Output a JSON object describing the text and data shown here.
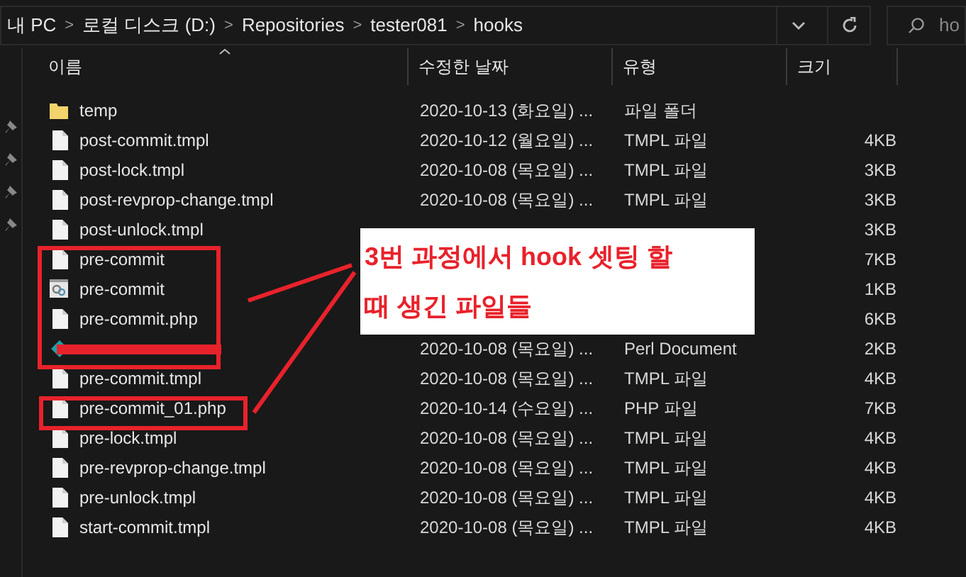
{
  "address_bar": {
    "crumbs": [
      "내 PC",
      "로컬 디스크 (D:)",
      "Repositories",
      "tester081",
      "hooks"
    ],
    "separator": ">"
  },
  "search": {
    "value": "ho"
  },
  "columns": [
    {
      "label": "이름",
      "sorted": true
    },
    {
      "label": "수정한 날짜",
      "sorted": false
    },
    {
      "label": "유형",
      "sorted": false
    },
    {
      "label": "크기",
      "sorted": false
    }
  ],
  "rows": [
    {
      "kind": "folder",
      "name": "temp",
      "date": "2020-10-13 (화요일) ...",
      "type": "파일 폴더",
      "size": ""
    },
    {
      "kind": "file",
      "name": "post-commit.tmpl",
      "date": "2020-10-12 (월요일) ...",
      "type": "TMPL 파일",
      "size": "4KB"
    },
    {
      "kind": "file",
      "name": "post-lock.tmpl",
      "date": "2020-10-08 (목요일) ...",
      "type": "TMPL 파일",
      "size": "3KB"
    },
    {
      "kind": "file",
      "name": "post-revprop-change.tmpl",
      "date": "2020-10-08 (목요일) ...",
      "type": "TMPL 파일",
      "size": "3KB"
    },
    {
      "kind": "file",
      "name": "post-unlock.tmpl",
      "date": "",
      "type": "",
      "size": "3KB"
    },
    {
      "kind": "file",
      "name": "pre-commit",
      "date": "",
      "type": "",
      "size": "7KB"
    },
    {
      "kind": "gear",
      "name": "pre-commit",
      "date": "",
      "type": "",
      "size": "1KB"
    },
    {
      "kind": "file",
      "name": "pre-commit.php",
      "date": "",
      "type": "",
      "size": "6KB"
    },
    {
      "kind": "perl",
      "name": "",
      "date": "2020-10-08 (목요일) ...",
      "type": "Perl Document",
      "size": "2KB"
    },
    {
      "kind": "file",
      "name": "pre-commit.tmpl",
      "date": "2020-10-08 (목요일) ...",
      "type": "TMPL 파일",
      "size": "4KB"
    },
    {
      "kind": "file",
      "name": "pre-commit_01.php",
      "date": "2020-10-14 (수요일) ...",
      "type": "PHP 파일",
      "size": "7KB"
    },
    {
      "kind": "file",
      "name": "pre-lock.tmpl",
      "date": "2020-10-08 (목요일) ...",
      "type": "TMPL 파일",
      "size": "4KB"
    },
    {
      "kind": "file",
      "name": "pre-revprop-change.tmpl",
      "date": "2020-10-08 (목요일) ...",
      "type": "TMPL 파일",
      "size": "4KB"
    },
    {
      "kind": "file",
      "name": "pre-unlock.tmpl",
      "date": "2020-10-08 (목요일) ...",
      "type": "TMPL 파일",
      "size": "4KB"
    },
    {
      "kind": "file",
      "name": "start-commit.tmpl",
      "date": "2020-10-08 (목요일) ...",
      "type": "TMPL 파일",
      "size": "4KB"
    }
  ],
  "annotation": {
    "lines": [
      "3번 과정에서 hook 셋팅 할",
      "때 생긴 파일들"
    ]
  }
}
